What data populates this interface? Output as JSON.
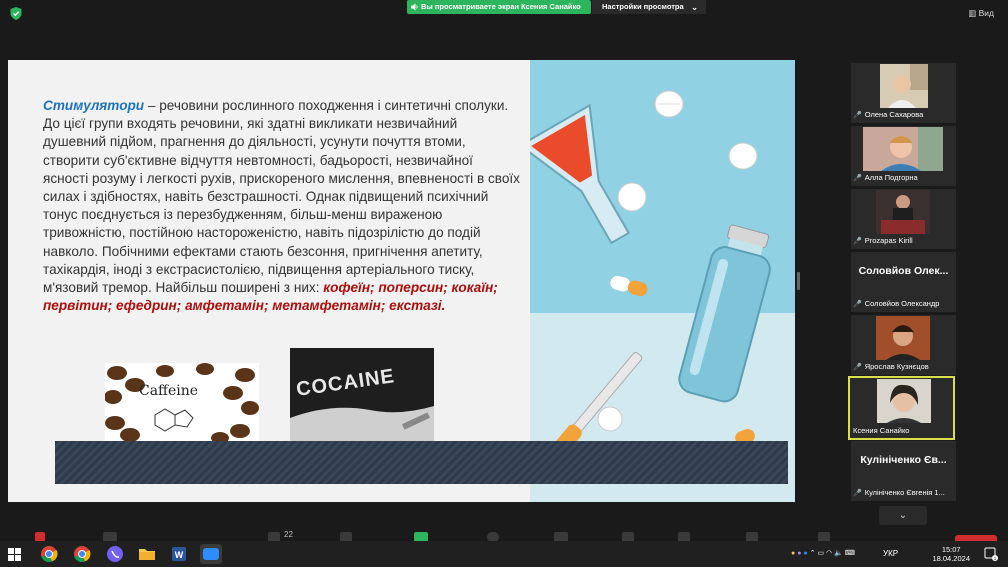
{
  "top_bar": {
    "sharing_notice": "Вы просматриваете экран Ксения Санайко",
    "view_settings_label": "Настройки просмотра",
    "view_button_label": "Вид"
  },
  "slide": {
    "term": "Стимулятори",
    "body": " – речовини рослинного походження і синтетичні сполуки. До цієї групи входять речовини, які здатні викликати незвичайний душевний підйом, прагнення до діяльності, усунути почуття втоми, створити суб'єктивне відчуття невтомності, бадьорості, незвичайної ясності розуму і легкості рухів, прискореного мислення, впевненості в своїх силах і здібностях, навіть безстрашності. Однак підвищений психічний тонус поєднується із перезбудженням, більш-менш вираженою тривожністю, постійною настороженістю, навіть підозрілістю до подій навколо. Побічними ефектами стають безсоння, пригнічення апетиту, тахікардія, іноді з екстрасистолією, підвищення артеріального тиску, м'язовий тремор. Найбільш поширені з них: ",
    "examples": "кофеїн; поперсин; кокаїн; первітин; ефедрин; амфетамін; метамфетамін; екстазі.",
    "image_caffeine_text": "Caffeine",
    "image_cocaine_text": "COCAINE"
  },
  "participants": [
    {
      "label": "Олена Сахарова",
      "has_video": true
    },
    {
      "label": "Алла Подгорна",
      "has_video": true
    },
    {
      "label": "Prozapas Kirill",
      "has_video": true
    },
    {
      "big_name": "Соловйов Олек...",
      "label": "Соловйов Олександр",
      "has_video": false
    },
    {
      "label": "Ярослав Кузнєцов",
      "has_video": true
    },
    {
      "label": "Ксения Санайко",
      "has_video": true,
      "active": true
    },
    {
      "big_name": "Кулініченко Єв...",
      "label": "Кулініченко Євгенія 1...",
      "has_video": false
    }
  ],
  "toolbar": {
    "participants_count": "22"
  },
  "taskbar": {
    "language": "УКР",
    "time": "15:07",
    "date": "18.04.2024",
    "notification_count": "1"
  },
  "colors": {
    "share_green": "#2db55d",
    "active_speaker_border": "#d8e04a",
    "slide_term_blue": "#1e73be",
    "slide_red": "#b00d0d",
    "end_button_red": "#d12d2d"
  }
}
